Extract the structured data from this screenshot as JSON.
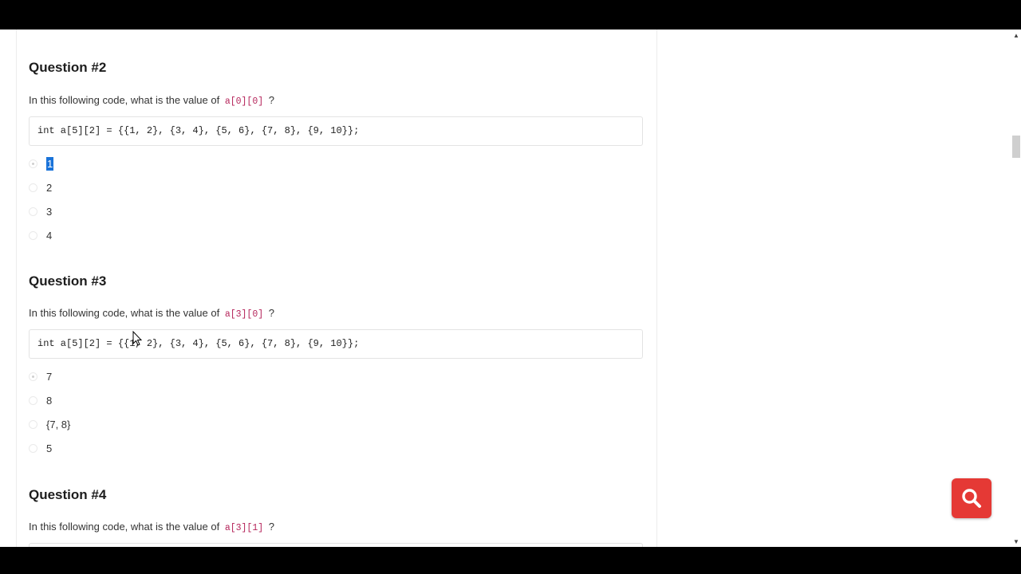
{
  "questions": [
    {
      "title": "Question #2",
      "prompt_prefix": "In this following code, what is the value of",
      "expr": "a[0][0]",
      "prompt_suffix": "?",
      "code": "int a[5][2] = {{1, 2}, {3, 4}, {5, 6}, {7, 8}, {9, 10}};",
      "options": [
        "1",
        "2",
        "3",
        "4"
      ],
      "selected_index": 0
    },
    {
      "title": "Question #3",
      "prompt_prefix": "In this following code, what is the value of",
      "expr": "a[3][0]",
      "prompt_suffix": "?",
      "code": "int a[5][2] = {{1, 2}, {3, 4}, {5, 6}, {7, 8}, {9, 10}};",
      "options": [
        "7",
        "8",
        "{7, 8}",
        "5"
      ],
      "selected_index": 0
    },
    {
      "title": "Question #4",
      "prompt_prefix": "In this following code, what is the value of",
      "expr": "a[3][1]",
      "prompt_suffix": "?"
    }
  ],
  "search_button": {
    "icon": "search-icon",
    "color": "#e53935"
  }
}
